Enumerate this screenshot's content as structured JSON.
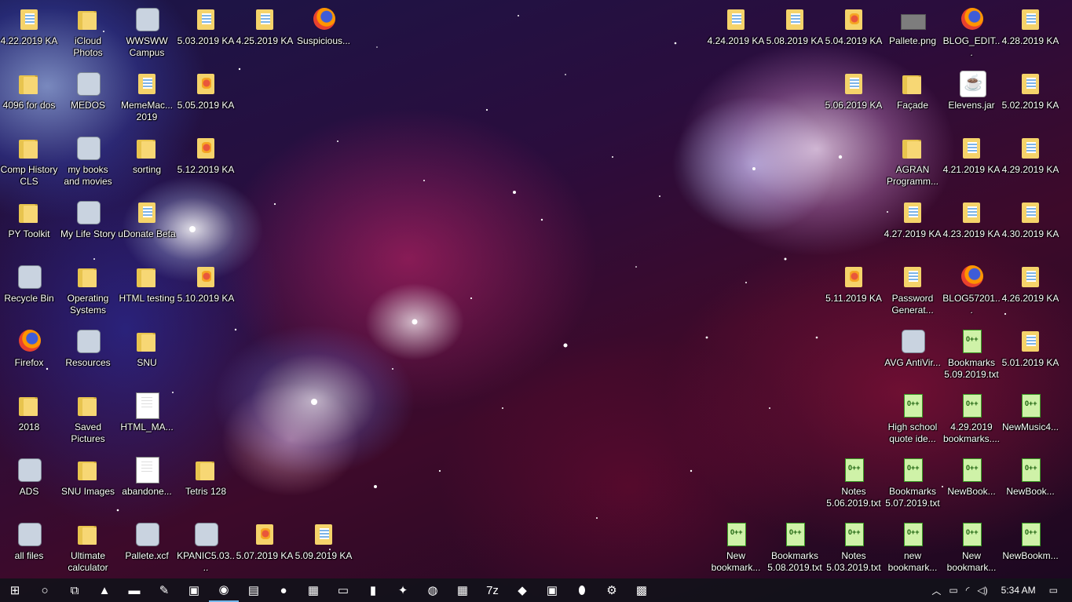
{
  "desktop": {
    "icons": [
      {
        "label": "4.22.2019 KA",
        "type": "zip"
      },
      {
        "label": "iCloud Photos",
        "type": "folder"
      },
      {
        "label": "WWSWW Campus",
        "type": "generic"
      },
      {
        "label": "5.03.2019 KA",
        "type": "zip"
      },
      {
        "label": "4.25.2019 KA",
        "type": "zip"
      },
      {
        "label": "Suspicious...",
        "type": "firefox"
      },
      {
        "label": "4.24.2019 KA",
        "type": "zip"
      },
      {
        "label": "5.08.2019 KA",
        "type": "zip"
      },
      {
        "label": "5.04.2019 KA",
        "type": "zip-red"
      },
      {
        "label": "Pallete.png",
        "type": "png"
      },
      {
        "label": "BLOG_EDIT...",
        "type": "firefox"
      },
      {
        "label": "4.28.2019 KA",
        "type": "zip"
      },
      {
        "label": "4096 for dos",
        "type": "folder"
      },
      {
        "label": "MEDOS",
        "type": "generic"
      },
      {
        "label": "MemeMac... 2019",
        "type": "zip"
      },
      {
        "label": "5.05.2019 KA",
        "type": "zip-red"
      },
      {
        "label": "5.06.2019 KA",
        "type": "zip"
      },
      {
        "label": "Façade",
        "type": "folder"
      },
      {
        "label": "Elevens.jar",
        "type": "jar"
      },
      {
        "label": "5.02.2019 KA",
        "type": "zip"
      },
      {
        "label": "Comp History CLS",
        "type": "folder"
      },
      {
        "label": "my books and movies",
        "type": "generic"
      },
      {
        "label": "sorting",
        "type": "folder"
      },
      {
        "label": "5.12.2019 KA",
        "type": "zip-red"
      },
      {
        "label": "AGRAN Programm...",
        "type": "folder"
      },
      {
        "label": "4.21.2019 KA",
        "type": "zip"
      },
      {
        "label": "4.29.2019 KA",
        "type": "zip"
      },
      {
        "label": "PY Toolkit",
        "type": "folder"
      },
      {
        "label": "My Life Story",
        "type": "generic"
      },
      {
        "label": "uDonate Beta",
        "type": "zip"
      },
      {
        "label": "4.27.2019 KA",
        "type": "zip"
      },
      {
        "label": "4.23.2019 KA",
        "type": "zip"
      },
      {
        "label": "4.30.2019 KA",
        "type": "zip"
      },
      {
        "label": "Recycle Bin",
        "type": "generic"
      },
      {
        "label": "Operating Systems",
        "type": "folder"
      },
      {
        "label": "HTML testing",
        "type": "folder"
      },
      {
        "label": "5.10.2019 KA",
        "type": "zip-red"
      },
      {
        "label": "5.11.2019 KA",
        "type": "zip-red"
      },
      {
        "label": "Password Generat...",
        "type": "zip"
      },
      {
        "label": "BLOG57201...",
        "type": "firefox"
      },
      {
        "label": "4.26.2019 KA",
        "type": "zip"
      },
      {
        "label": "Firefox",
        "type": "firefox"
      },
      {
        "label": "Resources",
        "type": "generic"
      },
      {
        "label": "SNU",
        "type": "folder"
      },
      {
        "label": "AVG AntiVir...",
        "type": "generic"
      },
      {
        "label": "Bookmarks 5.09.2019.txt",
        "type": "txt-npp"
      },
      {
        "label": "5.01.2019 KA",
        "type": "zip"
      },
      {
        "label": "2018",
        "type": "folder"
      },
      {
        "label": "Saved Pictures",
        "type": "folder"
      },
      {
        "label": "HTML_MA...",
        "type": "white-page"
      },
      {
        "label": "High school quote ide...",
        "type": "txt-npp"
      },
      {
        "label": "4.29.2019 bookmarks....",
        "type": "txt-npp"
      },
      {
        "label": "NewMusic4...",
        "type": "txt-npp"
      },
      {
        "label": "ADS",
        "type": "generic"
      },
      {
        "label": "SNU Images",
        "type": "folder"
      },
      {
        "label": "abandone...",
        "type": "white-page"
      },
      {
        "label": "Tetris 128",
        "type": "folder"
      },
      {
        "label": "Notes 5.06.2019.txt",
        "type": "txt-npp"
      },
      {
        "label": "Bookmarks 5.07.2019.txt",
        "type": "txt-npp"
      },
      {
        "label": "NewBook...",
        "type": "txt-npp"
      },
      {
        "label": "NewBook...",
        "type": "txt-npp"
      },
      {
        "label": "all files",
        "type": "generic"
      },
      {
        "label": "Ultimate calculator",
        "type": "folder"
      },
      {
        "label": "Pallete.xcf",
        "type": "generic"
      },
      {
        "label": "KPANIC5.03....",
        "type": "generic"
      },
      {
        "label": "5.07.2019 KA",
        "type": "zip-red"
      },
      {
        "label": "5.09.2019 KA",
        "type": "zip"
      },
      {
        "label": "New bookmark...",
        "type": "txt-npp"
      },
      {
        "label": "Bookmarks 5.08.2019.txt",
        "type": "txt-npp"
      },
      {
        "label": "Notes 5.03.2019.txt",
        "type": "txt-npp"
      },
      {
        "label": "new bookmark...",
        "type": "txt-npp"
      },
      {
        "label": "New bookmark...",
        "type": "txt-npp"
      },
      {
        "label": "NewBookm...",
        "type": "txt-npp"
      }
    ]
  },
  "taskbar": {
    "items": [
      {
        "name": "start",
        "glyph": "⊞"
      },
      {
        "name": "search",
        "glyph": "○"
      },
      {
        "name": "task-view",
        "glyph": "⧉"
      },
      {
        "name": "vlc",
        "glyph": "▲"
      },
      {
        "name": "file-explorer",
        "glyph": "▬"
      },
      {
        "name": "notepad-plus-plus",
        "glyph": "✎"
      },
      {
        "name": "photos",
        "glyph": "▣"
      },
      {
        "name": "app-active",
        "glyph": "◉"
      },
      {
        "name": "word-doc",
        "glyph": "▤"
      },
      {
        "name": "firefox",
        "glyph": "●"
      },
      {
        "name": "video-editor",
        "glyph": "▦"
      },
      {
        "name": "monitor-app",
        "glyph": "▭"
      },
      {
        "name": "sticky-notes",
        "glyph": "▮"
      },
      {
        "name": "gimp",
        "glyph": "✦"
      },
      {
        "name": "paint",
        "glyph": "◍"
      },
      {
        "name": "calculator",
        "glyph": "▦"
      },
      {
        "name": "7zip",
        "glyph": "7z"
      },
      {
        "name": "network-app",
        "glyph": "◆"
      },
      {
        "name": "archive",
        "glyph": "▣"
      },
      {
        "name": "lime",
        "glyph": "⬮"
      },
      {
        "name": "settings",
        "glyph": "⚙"
      },
      {
        "name": "app-grid",
        "glyph": "▩"
      }
    ],
    "tray": {
      "chevron": "︿",
      "battery": "▭",
      "wifi": "◜",
      "volume": "◁)",
      "time": "5:34 AM",
      "notifications": "▭"
    }
  }
}
